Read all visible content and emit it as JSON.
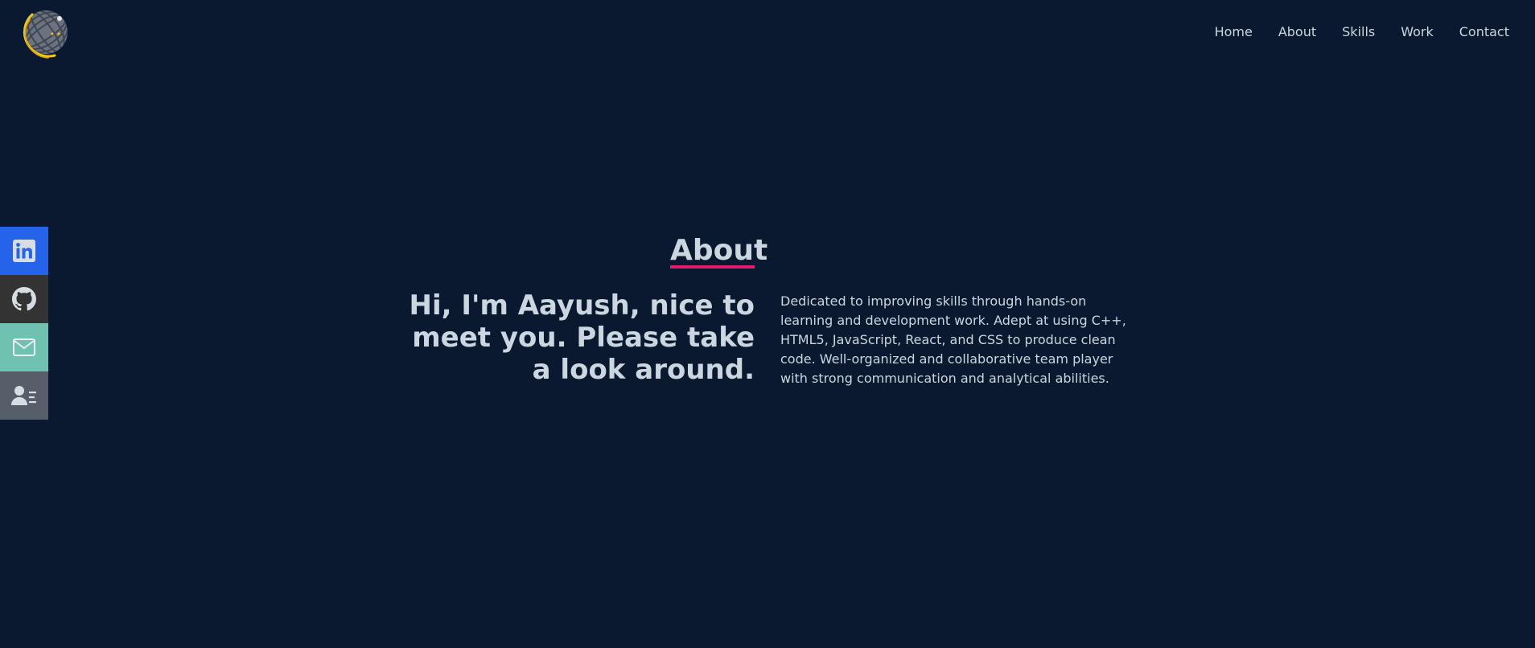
{
  "logo": {
    "alt": "logo"
  },
  "nav": {
    "items": [
      {
        "label": "Home"
      },
      {
        "label": "About"
      },
      {
        "label": "Skills"
      },
      {
        "label": "Work"
      },
      {
        "label": "Contact"
      }
    ]
  },
  "social": {
    "items": [
      {
        "icon": "linkedin-icon",
        "color": "#2563eb"
      },
      {
        "icon": "github-icon",
        "color": "#333333"
      },
      {
        "icon": "mail-icon",
        "color": "#6fc2b0"
      },
      {
        "icon": "resume-icon",
        "color": "#565f69"
      }
    ]
  },
  "about": {
    "title": "About",
    "greeting": "Hi, I'm Aayush, nice to meet you. Please take a look around.",
    "bio": "Dedicated to improving skills through hands-on learning and development work. Adept at using C++, HTML5, JavaScript, React, and CSS to produce clean code. Well-organized and collaborative team player with strong communication and analytical abilities.",
    "accent_color": "#e31b6d"
  },
  "colors": {
    "background": "#0a192f",
    "text": "#ccd6e0"
  }
}
